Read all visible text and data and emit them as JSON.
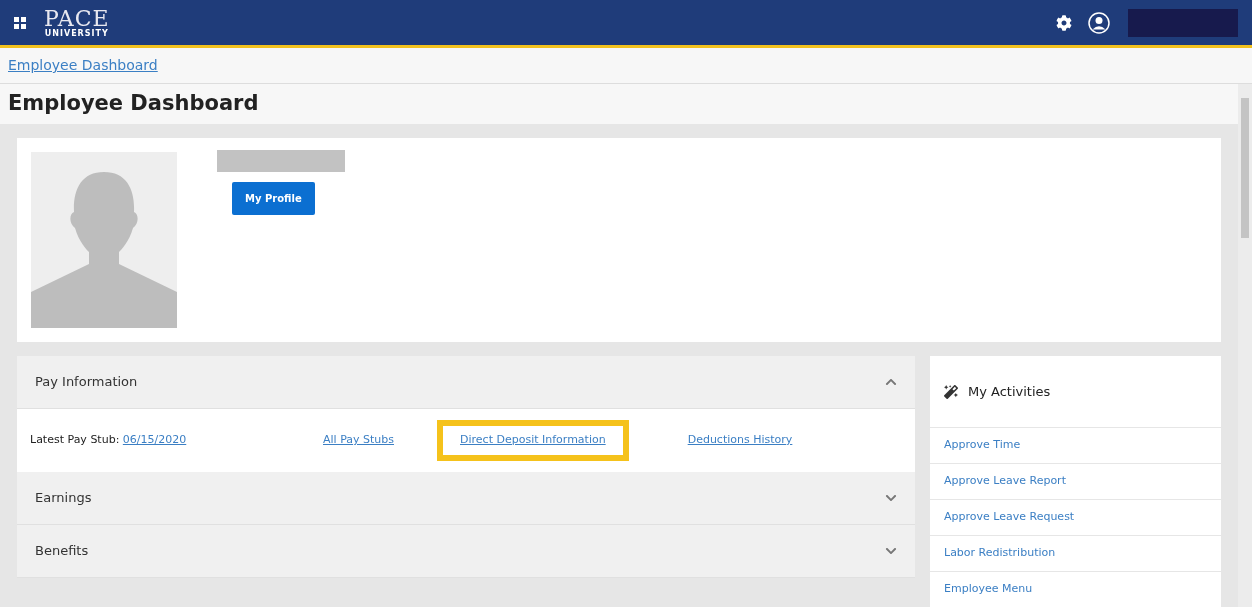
{
  "header": {
    "logo": {
      "name": "PACE",
      "subtitle": "UNIVERSITY"
    }
  },
  "breadcrumb": "Employee Dashboard",
  "page_title": "Employee Dashboard",
  "profile": {
    "button": "My Profile"
  },
  "sections": [
    {
      "title": "Pay Information",
      "expanded": true,
      "label": "Latest Pay Stub:",
      "date_link": "06/15/2020",
      "links": [
        {
          "text": "All Pay Stubs",
          "highlighted": false
        },
        {
          "text": "Direct Deposit Information",
          "highlighted": true
        },
        {
          "text": "Deductions History",
          "highlighted": false
        }
      ]
    },
    {
      "title": "Earnings",
      "expanded": false
    },
    {
      "title": "Benefits",
      "expanded": false
    }
  ],
  "activities": {
    "title": "My Activities",
    "items": [
      "Approve Time",
      "Approve Leave Report",
      "Approve Leave Request",
      "Labor Redistribution",
      "Employee Menu"
    ]
  }
}
